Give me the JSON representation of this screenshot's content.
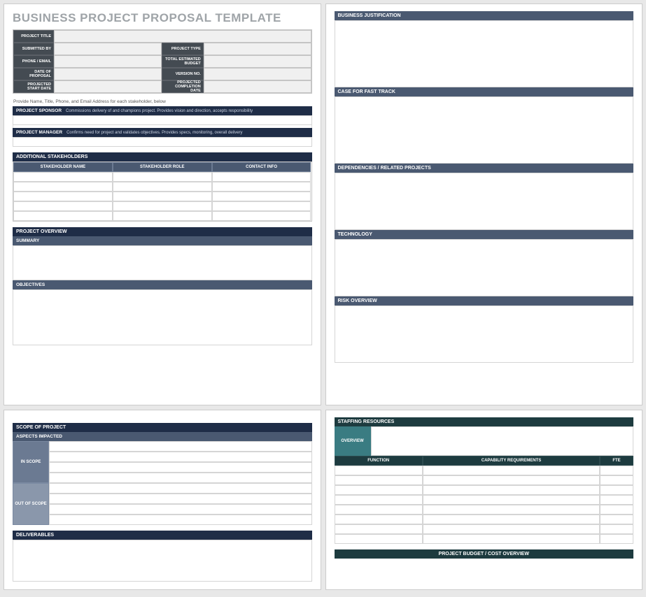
{
  "title": "BUSINESS PROJECT PROPOSAL TEMPLATE",
  "info": {
    "project_title": "PROJECT TITLE",
    "submitted_by": "SUBMITTED BY",
    "project_type": "PROJECT TYPE",
    "phone_email": "PHONE / EMAIL",
    "total_estimated_budget": "TOTAL ESTIMATED BUDGET",
    "date_of_proposal": "DATE OF PROPOSAL",
    "version_no": "VERSION NO.",
    "projected_start_date": "PROJECTED START DATE",
    "projected_completion_date": "PROJECTED COMPLETION DATE"
  },
  "instruction": "Provide Name, Title, Phone, and Email Address for each stakeholder, below",
  "sponsor": {
    "label": "PROJECT SPONSOR",
    "desc": "Commissions delivery of and champions project. Provides vision and direction, accepts responsibility"
  },
  "manager": {
    "label": "PROJECT MANAGER",
    "desc": "Confirms need for project and validates objectives. Provides specs, monitoring, overall delivery"
  },
  "stakeholders": {
    "title": "ADDITIONAL STAKEHOLDERS",
    "cols": [
      "STAKEHOLDER NAME",
      "STAKEHOLDER ROLE",
      "CONTACT INFO"
    ]
  },
  "overview": {
    "title": "PROJECT OVERVIEW",
    "summary": "SUMMARY",
    "objectives": "OBJECTIVES"
  },
  "page2": {
    "business_justification": "BUSINESS JUSTIFICATION",
    "case_fast_track": "CASE FOR FAST TRACK",
    "dependencies": "DEPENDENCIES / RELATED PROJECTS",
    "technology": "TECHNOLOGY",
    "risk_overview": "RISK OVERVIEW"
  },
  "page3": {
    "scope_title": "SCOPE OF PROJECT",
    "aspects_impacted": "ASPECTS IMPACTED",
    "in_scope": "IN SCOPE",
    "out_of_scope": "OUT OF SCOPE",
    "deliverables": "DELIVERABLES"
  },
  "page4": {
    "staffing_resources": "STAFFING RESOURCES",
    "overview": "OVERVIEW",
    "cols": [
      "FUNCTION",
      "CAPABILITY REQUIREMENTS",
      "FTE"
    ],
    "budget_title": "PROJECT BUDGET / COST OVERVIEW"
  }
}
